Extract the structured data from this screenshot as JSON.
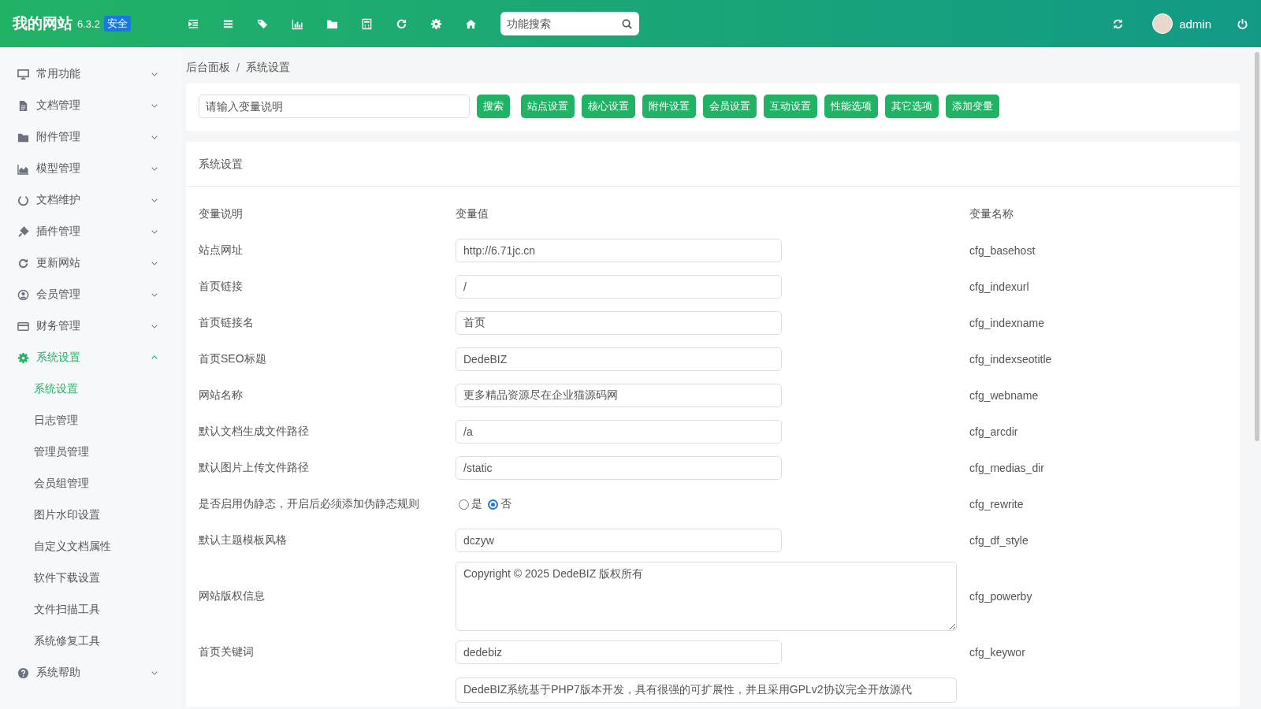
{
  "header": {
    "logo": "我的网站",
    "version": "6.3.2",
    "badge": "安全",
    "search": {
      "placeholder": "功能搜索"
    },
    "user": "admin"
  },
  "sidebar": {
    "items": [
      {
        "label": "常用功能",
        "expanded": false,
        "selected": false
      },
      {
        "label": "文档管理",
        "expanded": false,
        "selected": false
      },
      {
        "label": "附件管理",
        "expanded": false,
        "selected": false
      },
      {
        "label": "模型管理",
        "expanded": false,
        "selected": false
      },
      {
        "label": "文档维护",
        "expanded": false,
        "selected": false
      },
      {
        "label": "插件管理",
        "expanded": false,
        "selected": false
      },
      {
        "label": "更新网站",
        "expanded": false,
        "selected": false
      },
      {
        "label": "会员管理",
        "expanded": false,
        "selected": false
      },
      {
        "label": "财务管理",
        "expanded": false,
        "selected": false
      },
      {
        "label": "系统设置",
        "expanded": true,
        "selected": true,
        "children": [
          {
            "label": "系统设置",
            "selected": true
          },
          {
            "label": "日志管理",
            "selected": false
          },
          {
            "label": "管理员管理",
            "selected": false
          },
          {
            "label": "会员组管理",
            "selected": false
          },
          {
            "label": "图片水印设置",
            "selected": false
          },
          {
            "label": "自定义文档属性",
            "selected": false
          },
          {
            "label": "软件下载设置",
            "selected": false
          },
          {
            "label": "文件扫描工具",
            "selected": false
          },
          {
            "label": "系统修复工具",
            "selected": false
          }
        ]
      },
      {
        "label": "系统帮助",
        "expanded": false,
        "selected": false
      }
    ]
  },
  "breadcrumb": {
    "separator": "/",
    "items": [
      "后台面板",
      "系统设置"
    ]
  },
  "toolbar": {
    "search": {
      "placeholder": "请输入变量说明"
    },
    "buttons": [
      "搜索",
      "站点设置",
      "核心设置",
      "附件设置",
      "会员设置",
      "互动设置",
      "性能选项",
      "其它选项",
      "添加变量"
    ]
  },
  "settings": {
    "title": "系统设置",
    "columns": [
      "变量说明",
      "变量值",
      "变量名称"
    ],
    "rows": [
      {
        "kind": "input",
        "label": "站点网址",
        "value": "http://6.71jc.cn",
        "name": "cfg_basehost"
      },
      {
        "kind": "input",
        "label": "首页链接",
        "value": "/",
        "name": "cfg_indexurl"
      },
      {
        "kind": "input",
        "label": "首页链接名",
        "value": "首页",
        "name": "cfg_indexname"
      },
      {
        "kind": "input",
        "label": "首页SEO标题",
        "value": "DedeBIZ",
        "name": "cfg_indexseotitle"
      },
      {
        "kind": "input",
        "label": "网站名称",
        "value": "更多精品资源尽在企业猫源码网",
        "name": "cfg_webname"
      },
      {
        "kind": "input",
        "label": "默认文档生成文件路径",
        "value": "/a",
        "name": "cfg_arcdir"
      },
      {
        "kind": "input",
        "label": "默认图片上传文件路径",
        "value": "/static",
        "name": "cfg_medias_dir"
      },
      {
        "kind": "radio",
        "label": "是否启用伪静态，开启后必须添加伪静态规则",
        "options": [
          {
            "label": "是",
            "selected": false
          },
          {
            "label": "否",
            "selected": true
          }
        ],
        "name": "cfg_rewrite"
      },
      {
        "kind": "input",
        "label": "默认主题模板风格",
        "value": "dczyw",
        "name": "cfg_df_style"
      },
      {
        "kind": "textarea",
        "label": "网站版权信息",
        "value": "Copyright © 2025 DedeBIZ 版权所有",
        "name": "cfg_powerby"
      },
      {
        "kind": "input",
        "label": "首页关键词",
        "value": "dedebiz",
        "name": "cfg_keywor"
      },
      {
        "kind": "textarea_cut",
        "value": "DedeBIZ系统基于PHP7版本开发，具有很强的可扩展性，并且采用GPLv2协议完全开放源代"
      }
    ]
  }
}
